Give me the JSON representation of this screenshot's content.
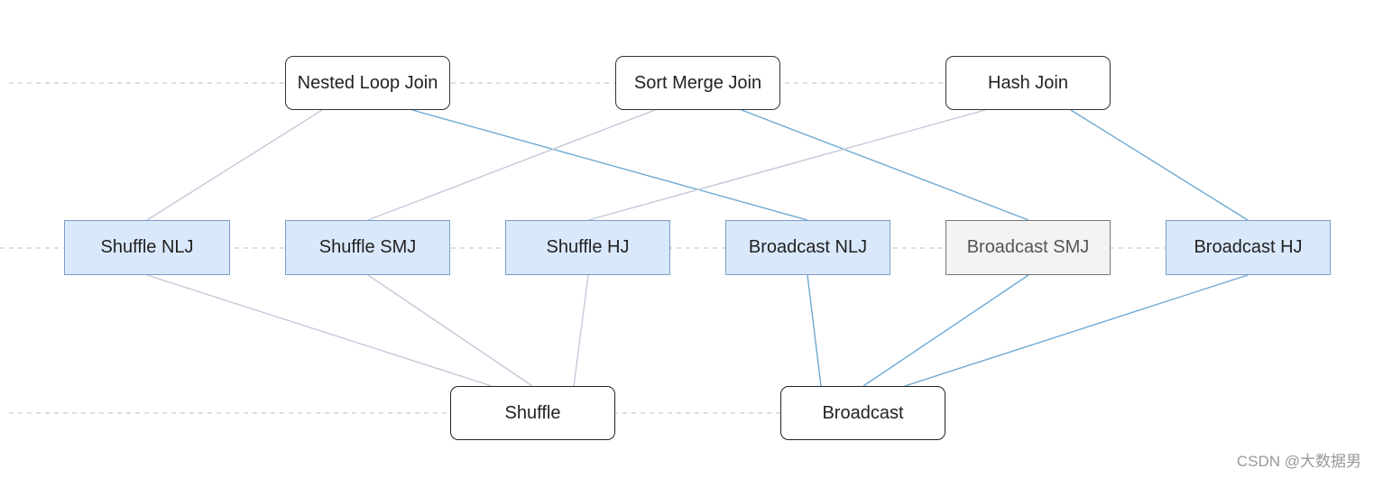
{
  "nodes": [
    {
      "id": "nlj",
      "label": "Nested Loop Join",
      "kind": "join"
    },
    {
      "id": "smj",
      "label": "Sort Merge Join",
      "kind": "join"
    },
    {
      "id": "hj",
      "label": "Hash Join",
      "kind": "join"
    },
    {
      "id": "snlj",
      "label": "Shuffle NLJ",
      "kind": "impl"
    },
    {
      "id": "ssmj",
      "label": "Shuffle SMJ",
      "kind": "impl"
    },
    {
      "id": "shj",
      "label": "Shuffle HJ",
      "kind": "impl"
    },
    {
      "id": "bnlj",
      "label": "Broadcast NLJ",
      "kind": "impl"
    },
    {
      "id": "bsmj",
      "label": "Broadcast SMJ",
      "kind": "impl",
      "disabled": true
    },
    {
      "id": "bhj",
      "label": "Broadcast HJ",
      "kind": "impl"
    },
    {
      "id": "shuffle",
      "label": "Shuffle",
      "kind": "dist"
    },
    {
      "id": "broadcast",
      "label": "Broadcast",
      "kind": "dist"
    }
  ],
  "edges": [
    {
      "from": "nlj",
      "to": "snlj",
      "type": "shuffle"
    },
    {
      "from": "nlj",
      "to": "bnlj",
      "type": "broadcast"
    },
    {
      "from": "smj",
      "to": "ssmj",
      "type": "shuffle"
    },
    {
      "from": "smj",
      "to": "bsmj",
      "type": "broadcast"
    },
    {
      "from": "hj",
      "to": "shj",
      "type": "shuffle"
    },
    {
      "from": "hj",
      "to": "bhj",
      "type": "broadcast"
    },
    {
      "from": "snlj",
      "to": "shuffle",
      "type": "shuffle"
    },
    {
      "from": "ssmj",
      "to": "shuffle",
      "type": "shuffle"
    },
    {
      "from": "shj",
      "to": "shuffle",
      "type": "shuffle"
    },
    {
      "from": "bnlj",
      "to": "broadcast",
      "type": "broadcast"
    },
    {
      "from": "bsmj",
      "to": "broadcast",
      "type": "broadcast"
    },
    {
      "from": "bhj",
      "to": "broadcast",
      "type": "broadcast"
    }
  ],
  "colors": {
    "shuffle_edge": "#c3cad8",
    "broadcast_edge": "#6eaad3",
    "impl_fill": "#dae8fb",
    "disabled_fill": "#f3f3f3",
    "dashed": "#bbbbbb"
  },
  "watermark": "CSDN @大数据男"
}
